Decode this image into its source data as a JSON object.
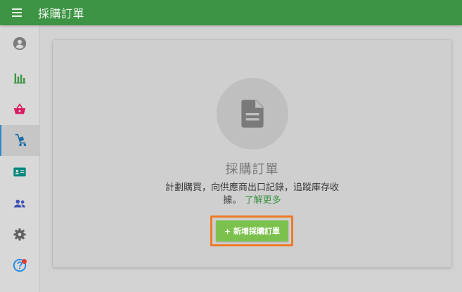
{
  "header": {
    "title": "採購訂單",
    "menu_icon": "hamburger-menu-icon"
  },
  "sidebar": {
    "items": [
      {
        "id": "profile",
        "icon": "account-circle-icon",
        "color": "#7b7b7b",
        "active": false
      },
      {
        "id": "analytics",
        "icon": "bar-chart-icon",
        "color": "#3d9444",
        "active": false
      },
      {
        "id": "sales",
        "icon": "shopping-basket-icon",
        "color": "#d81b60",
        "active": false
      },
      {
        "id": "purchasing",
        "icon": "hand-truck-icon",
        "color": "#1e6fa8",
        "active": true
      },
      {
        "id": "contacts",
        "icon": "contact-card-icon",
        "color": "#00897b",
        "active": false
      },
      {
        "id": "people",
        "icon": "people-icon",
        "color": "#3f51b5",
        "active": false
      },
      {
        "id": "settings",
        "icon": "gear-icon",
        "color": "#616161",
        "active": false
      },
      {
        "id": "help",
        "icon": "help-icon",
        "color": "#1e88e5",
        "active": false,
        "notification": true
      }
    ]
  },
  "empty_state": {
    "icon": "document-icon",
    "title": "採購訂單",
    "description": "計劃購買，向供應商出口記錄，追蹤庫存收據。",
    "learn_more": "了解更多",
    "cta_label": "+ 新增採購訂單"
  },
  "colors": {
    "header": "#3d9444",
    "cta": "#7cc14d",
    "highlight": "#ef7a27",
    "link": "#3d9444"
  }
}
